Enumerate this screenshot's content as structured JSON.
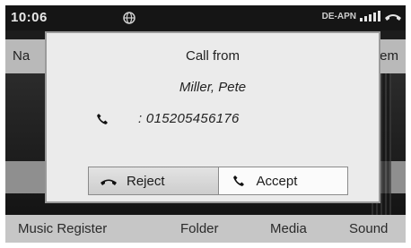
{
  "status_bar": {
    "time": "10:06",
    "network": "DE-APN",
    "center_icon": "globe-icon",
    "signal_icon": "signal-strength-icon",
    "phone_status_icon": "handset-hangup-icon"
  },
  "top_menu": {
    "left_label": "Na",
    "right_label": "em"
  },
  "dialog": {
    "title": "Call from",
    "caller_name": "Miller, Pete",
    "number": ": 015205456176",
    "number_icon": "phone-icon",
    "reject_label": "Reject",
    "reject_icon": "hang-up-icon",
    "accept_label": "Accept",
    "accept_icon": "phone-icon"
  },
  "bottom_menu": {
    "items": [
      "Music Register",
      "Folder",
      "Media",
      "Sound"
    ]
  },
  "colors": {
    "screen_bg": "#1c1c1c",
    "dialog_bg": "#ebebeb",
    "menu_bg": "#c6c6c6",
    "highlight_bg": "#8f8f8f"
  }
}
